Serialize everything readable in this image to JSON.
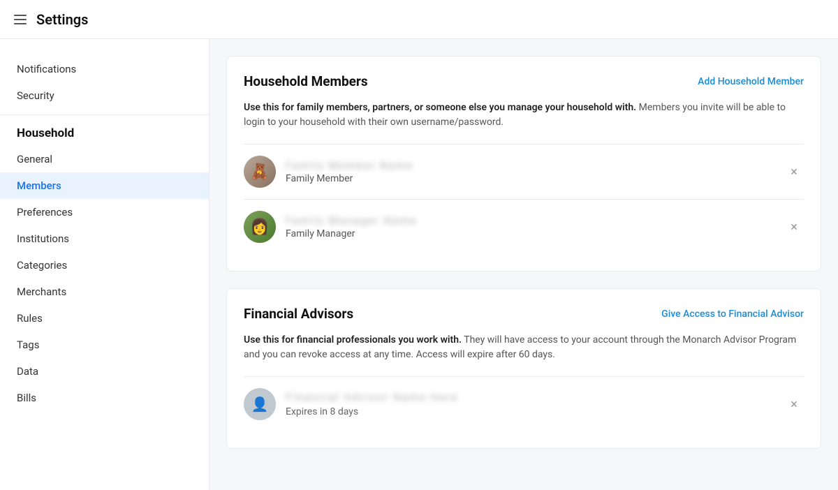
{
  "header": {
    "title": "Settings"
  },
  "sidebar": {
    "top_items": [
      {
        "label": "Notifications",
        "id": "notifications"
      },
      {
        "label": "Security",
        "id": "security"
      }
    ],
    "household_header": "Household",
    "household_items": [
      {
        "label": "General",
        "id": "general",
        "active": false
      },
      {
        "label": "Members",
        "id": "members",
        "active": true
      },
      {
        "label": "Preferences",
        "id": "preferences",
        "active": false
      },
      {
        "label": "Institutions",
        "id": "institutions",
        "active": false
      },
      {
        "label": "Categories",
        "id": "categories",
        "active": false
      },
      {
        "label": "Merchants",
        "id": "merchants",
        "active": false
      },
      {
        "label": "Rules",
        "id": "rules",
        "active": false
      },
      {
        "label": "Tags",
        "id": "tags",
        "active": false
      },
      {
        "label": "Data",
        "id": "data",
        "active": false
      },
      {
        "label": "Bills",
        "id": "bills",
        "active": false
      }
    ]
  },
  "household_members": {
    "title": "Household Members",
    "action_label": "Add Household Member",
    "description_bold": "Use this for family members, partners, or someone else you manage your household with.",
    "description_rest": " Members you invite will be able to login to your household with their own username/password.",
    "members": [
      {
        "name_blurred": "xxxxxxxxxxxxxxx",
        "role": "Family Member",
        "avatar_type": "bear",
        "avatar_icon": "🧸"
      },
      {
        "name_blurred": "xxxxxxxxxxxxxxxx",
        "role": "Family Manager",
        "avatar_type": "woman",
        "avatar_icon": "👩"
      }
    ]
  },
  "financial_advisors": {
    "title": "Financial Advisors",
    "action_label": "Give Access to Financial Advisor",
    "description_bold": "Use this for financial professionals you work with.",
    "description_rest": " They will have access to your account through the Monarch Advisor Program and you can revoke access at any time. Access will expire after 60 days.",
    "advisors": [
      {
        "name_blurred": "xxxxxxxxxxxxxxxxxxxxxxxx",
        "expires": "Expires in 8 days",
        "avatar_type": "generic",
        "avatar_icon": "👤"
      }
    ]
  }
}
